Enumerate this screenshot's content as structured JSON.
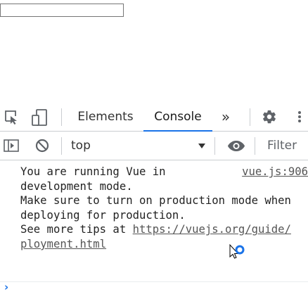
{
  "page": {
    "input_value": ""
  },
  "toolbar": {
    "tabs": [
      {
        "label": "Elements",
        "active": false
      },
      {
        "label": "Console",
        "active": true
      }
    ],
    "more_tabs_glyph": "»",
    "icons": [
      "inspect-element-icon",
      "device-toolbar-icon",
      "more-tabs-icon",
      "settings-gear-icon",
      "kebab-menu-icon"
    ]
  },
  "console_bar": {
    "context": "top",
    "filter_placeholder": "Filter",
    "icons": [
      "show-sidebar-icon",
      "clear-console-icon",
      "context-dropdown-icon",
      "live-expression-eye-icon"
    ]
  },
  "console": {
    "message": {
      "lines": [
        "You are running Vue in",
        "development mode.",
        "Make sure to turn on production mode when",
        "deploying for production."
      ],
      "tips_prefix": "See more tips at ",
      "tips_link_line1": "https://vuejs.org/guide/deployment.html",
      "tips_link_line1_visible": "https://vuejs.org/guide/",
      "tips_link_line2": "ployment.html",
      "source": "vue.js:906"
    },
    "prompt_glyph": "›"
  },
  "colors": {
    "accent": "#1a73e8",
    "border": "#cacdd1",
    "text": "#333333",
    "link": "#555555"
  }
}
